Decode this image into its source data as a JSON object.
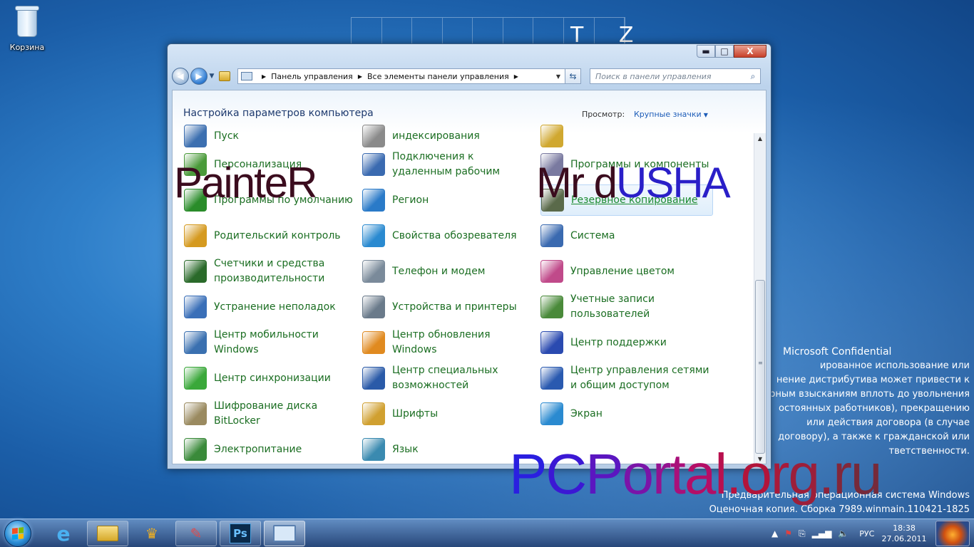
{
  "desktop": {
    "recycle_bin_label": "Корзина",
    "wallpaper_letters": "T Z",
    "confidential": {
      "title": "Microsoft Confidential",
      "lines": [
        "ированное использование или",
        "нение дистрибутива может привести к",
        "рным взысканиям вплоть до увольнения",
        "остоянных работников), прекращению",
        "или действия договора (в случае",
        "договору), а также к гражданской или",
        "тветственности."
      ]
    },
    "build_info": {
      "line1": "Предварительная операционная система Windows",
      "line2": "Оценочная копия. Сборка 7989.winmain.110421-1825"
    }
  },
  "watermarks": {
    "left": "PainteR",
    "right_a": "Mr d",
    "right_b": "USHA",
    "bottom": "PCPortal.org.ru"
  },
  "window": {
    "controls": {
      "minimize": "▬",
      "maximize": "□",
      "close": "X"
    },
    "address": {
      "root_sep": "▶",
      "crumbs": [
        "Панель управления",
        "Все элементы панели управления"
      ],
      "dropdown": "▼"
    },
    "search_placeholder": "Поиск в панели управления",
    "header_title": "Настройка параметров компьютера",
    "view_label": "Просмотр:",
    "view_value": "Крупные значки",
    "columns": [
      [
        {
          "label": "Пуск",
          "icon": "taskbar-start-icon",
          "color": "#3c6fb0"
        },
        {
          "label": "Персонализация",
          "icon": "personalization-icon",
          "color": "#4a9a3a"
        },
        {
          "label": "Программы по умолчанию",
          "icon": "default-programs-icon",
          "color": "#2a8c2a"
        },
        {
          "label": "Родительский контроль",
          "icon": "parental-control-icon",
          "color": "#d59a20"
        },
        {
          "label": "Счетчики и средства производительности",
          "icon": "performance-icon",
          "color": "#2a6a2a"
        },
        {
          "label": "Устранение неполадок",
          "icon": "troubleshooting-icon",
          "color": "#3a6fb8"
        },
        {
          "label": "Центр мобильности Windows",
          "icon": "mobility-center-icon",
          "color": "#3a70b0"
        },
        {
          "label": "Центр синхронизации",
          "icon": "sync-center-icon",
          "color": "#3aa83a"
        },
        {
          "label": "Шифрование диска BitLocker",
          "icon": "bitlocker-icon",
          "color": "#9a8a60"
        },
        {
          "label": "Электропитание",
          "icon": "power-options-icon",
          "color": "#3a8a3a"
        }
      ],
      [
        {
          "label": "индексирования",
          "icon": "indexing-icon",
          "color": "#8a8a8a"
        },
        {
          "label": "Подключения к удаленным рабочим",
          "icon": "remote-desktop-icon",
          "color": "#3a6ab0"
        },
        {
          "label": "Регион",
          "icon": "region-icon",
          "color": "#2a7ac8"
        },
        {
          "label": "Свойства обозревателя",
          "icon": "internet-options-icon",
          "color": "#2a8ad0"
        },
        {
          "label": "Телефон и модем",
          "icon": "phone-modem-icon",
          "color": "#7a8a9a"
        },
        {
          "label": "Устройства и принтеры",
          "icon": "devices-printers-icon",
          "color": "#6a7a8a"
        },
        {
          "label": "Центр обновления Windows",
          "icon": "windows-update-icon",
          "color": "#e08a20"
        },
        {
          "label": "Центр специальных возможностей",
          "icon": "ease-of-access-icon",
          "color": "#2a5aa8"
        },
        {
          "label": "Шрифты",
          "icon": "fonts-icon",
          "color": "#d0a030"
        },
        {
          "label": "Язык",
          "icon": "language-icon",
          "color": "#3a8ab0"
        }
      ],
      [
        {
          "label": "",
          "icon": "folder-icon",
          "color": "#d0a830"
        },
        {
          "label": "Программы и компоненты",
          "icon": "programs-features-icon",
          "color": "#7a7aa0"
        },
        {
          "label": "Резервное копирование",
          "icon": "backup-restore-icon",
          "color": "#5a6a4a"
        },
        {
          "label": "Система",
          "icon": "system-icon",
          "color": "#3a6ab0"
        },
        {
          "label": "Управление цветом",
          "icon": "color-management-icon",
          "color": "#c04a8a"
        },
        {
          "label": "Учетные записи пользователей",
          "icon": "user-accounts-icon",
          "color": "#4a8a3a"
        },
        {
          "label": "Центр поддержки",
          "icon": "action-center-icon",
          "color": "#2a4ab0"
        },
        {
          "label": "Центр управления сетями и общим доступом",
          "icon": "network-center-icon",
          "color": "#2a5ab0"
        },
        {
          "label": "Экран",
          "icon": "display-icon",
          "color": "#2a8ad0"
        }
      ]
    ]
  },
  "taskbar": {
    "language": "РУС",
    "time": "18:38",
    "date": "27.06.2011",
    "ps_label": "Ps"
  }
}
